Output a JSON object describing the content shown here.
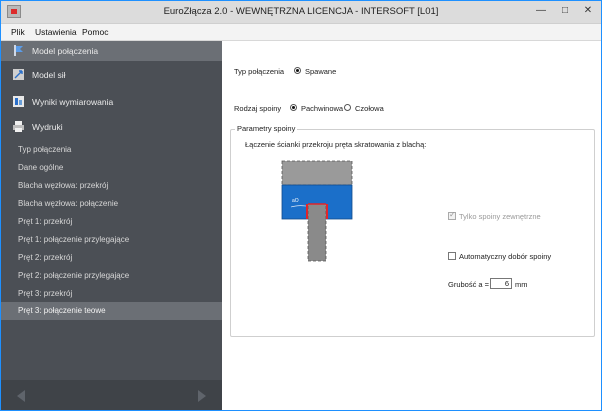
{
  "window": {
    "title": "EuroZłącza 2.0 - WEWNĘTRZNA LICENCJA - INTERSOFT [L01]"
  },
  "menu": {
    "items": [
      "Plik",
      "Ustawienia",
      "Pomoc"
    ]
  },
  "sidebar": {
    "main": [
      {
        "label": "Model połączenia",
        "icon": "connection-model-icon",
        "selected": true
      },
      {
        "label": "Model sił",
        "icon": "force-model-icon",
        "selected": false
      },
      {
        "label": "Wyniki wymiarowania",
        "icon": "results-icon",
        "selected": false
      },
      {
        "label": "Wydruki",
        "icon": "printer-icon",
        "selected": false
      }
    ],
    "sub": [
      {
        "label": "Typ połączenia",
        "selected": false
      },
      {
        "label": "Dane ogólne",
        "selected": false
      },
      {
        "label": "Blacha węzłowa: przekrój",
        "selected": false
      },
      {
        "label": "Blacha węzłowa: połączenie",
        "selected": false
      },
      {
        "label": "Pręt 1: przekrój",
        "selected": false
      },
      {
        "label": "Pręt 1: połączenie przylegające",
        "selected": false
      },
      {
        "label": "Pręt 2: przekrój",
        "selected": false
      },
      {
        "label": "Pręt 2: połączenie przylegające",
        "selected": false
      },
      {
        "label": "Pręt 3: przekrój",
        "selected": false
      },
      {
        "label": "Pręt 3: połączenie teowe",
        "selected": true
      }
    ]
  },
  "content": {
    "connection_type_label": "Typ połączenia",
    "connection_type_value": "Spawane",
    "weld_type_label": "Rodzaj spoiny",
    "weld_type_options": [
      {
        "label": "Pachwinowa",
        "checked": true
      },
      {
        "label": "Czołowa",
        "checked": false
      }
    ],
    "group_title": "Parametry spoiny",
    "description": "Łączenie ścianki przekroju pręta skratowania z blachą:",
    "diagram_label": "aO",
    "only_external_label": "Tylko spoiny zewnętrzne",
    "auto_select_label": "Automatyczny dobór spoiny",
    "thickness_label": "Grubość  a =",
    "thickness_value": "6",
    "thickness_unit": "mm"
  },
  "colors": {
    "sidebar": "#4b4f55",
    "selected": "#6b6f75",
    "plate": "#1b6fc9",
    "weld": "#e0252b",
    "member": "#8a8a8a"
  }
}
